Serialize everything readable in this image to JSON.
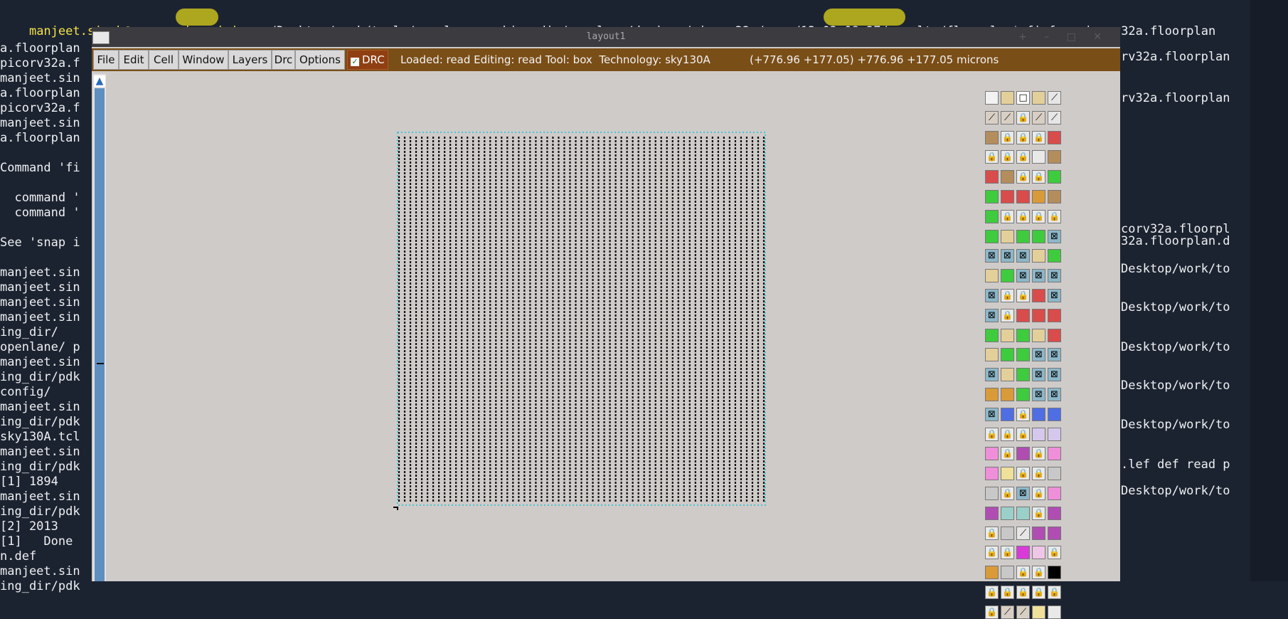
{
  "terminal": {
    "prompt_user": "manjeet.singh@ansys-pd-workshop",
    "prompt_path": ":~/Desktop/work/tools/openlane_working_dir/openlane/designs/picorv32a/runs/13-02_08-27/results/floorplan$",
    "command": " firfox picorv32a.floorplan",
    "left_lines": [
      "a.floorplan",
      "picorv32a.f",
      "manjeet.sin",
      "a.floorplan",
      "picorv32a.f",
      "manjeet.sin",
      "a.floorplan",
      "",
      "Command 'fi",
      "",
      "  command '",
      "  command '",
      "",
      "See 'snap i",
      "",
      "manjeet.sin",
      "manjeet.sin",
      "manjeet.sin",
      "manjeet.sin",
      "ing_dir/",
      "openlane/ p",
      "manjeet.sin",
      "ing_dir/pdk",
      "config/",
      "manjeet.sin",
      "ing_dir/pdk",
      "sky130A.tcl",
      "manjeet.sin",
      "ing_dir/pdk",
      "[1] 1894",
      "manjeet.sin",
      "ing_dir/pdk",
      "[2] 2013",
      "[1]   Done",
      "n.def",
      "manjeet.sin",
      "ing_dir/pdk"
    ],
    "right_lines": [
      "rv32a.floorplan",
      "rv32a.floorplan",
      "corv32a.floorpl",
      "32a.floorplan.d",
      "Desktop/work/to",
      "Desktop/work/to",
      "Desktop/work/to",
      "Desktop/work/to",
      "Desktop/work/to",
      ".lef def read p",
      "Desktop/work/to"
    ]
  },
  "magic": {
    "window_title": "layout1",
    "menu": [
      "File",
      "Edit",
      "Cell",
      "Window",
      "Layers",
      "Drc",
      "Options"
    ],
    "drc_label": "DRC",
    "status_loaded": "Loaded: read Editing: read Tool: box  Technology: sky130A",
    "status_coords": "(+776.96 +177.05) +776.96 +177.05 microns",
    "colors": {
      "menubar": "#7a4e17",
      "drc_button": "#8f3f12",
      "canvas": "#cfcbc9",
      "rows": "#111111",
      "boundary": "#4bc3d6",
      "terminal_bg": "#1c2330",
      "highlight": "#c7bd1c"
    },
    "palette_icons": [
      "grid",
      "tan",
      "box",
      "tan",
      "diagonal",
      "hatch",
      "hatch",
      "lock",
      "hatch",
      "diagonal",
      "brown",
      "lock",
      "lock",
      "lock",
      "red",
      "lock",
      "lock",
      "lock",
      "blank",
      "brown",
      "red",
      "brown",
      "lock",
      "lock",
      "green",
      "green",
      "red",
      "red",
      "orange",
      "brown",
      "green",
      "lock",
      "lock",
      "lock",
      "lock",
      "green",
      "tan",
      "green",
      "green",
      "cross",
      "cross",
      "cross",
      "cross",
      "tan",
      "green",
      "tan",
      "green",
      "cross",
      "cross",
      "cross",
      "cross",
      "lock",
      "lock",
      "red",
      "cross",
      "cross",
      "lock",
      "red",
      "red",
      "red",
      "green",
      "tan",
      "green",
      "tan",
      "red",
      "tan",
      "green",
      "green",
      "cross",
      "cross",
      "cross",
      "tan",
      "green",
      "cross",
      "cross",
      "orange",
      "orange",
      "green",
      "cross",
      "cross",
      "cross",
      "blue",
      "lock",
      "blue",
      "blue",
      "lock",
      "lock",
      "lock",
      "lavender",
      "lavender",
      "pink",
      "lock",
      "purple",
      "lock",
      "pink",
      "pink",
      "yellow",
      "lock",
      "lock",
      "grey",
      "grey",
      "lock",
      "cross",
      "lock",
      "pink",
      "purple",
      "teal",
      "teal",
      "lock",
      "purple",
      "lock",
      "grey",
      "diagonal",
      "purple",
      "purple",
      "lock",
      "lock",
      "magenta",
      "pinkhatch",
      "lock",
      "orange",
      "grey",
      "lock",
      "lock",
      "black",
      "lock",
      "lock",
      "lock",
      "lock",
      "lock",
      "lock",
      "hatch",
      "hatch",
      "yellow",
      "blank"
    ]
  }
}
